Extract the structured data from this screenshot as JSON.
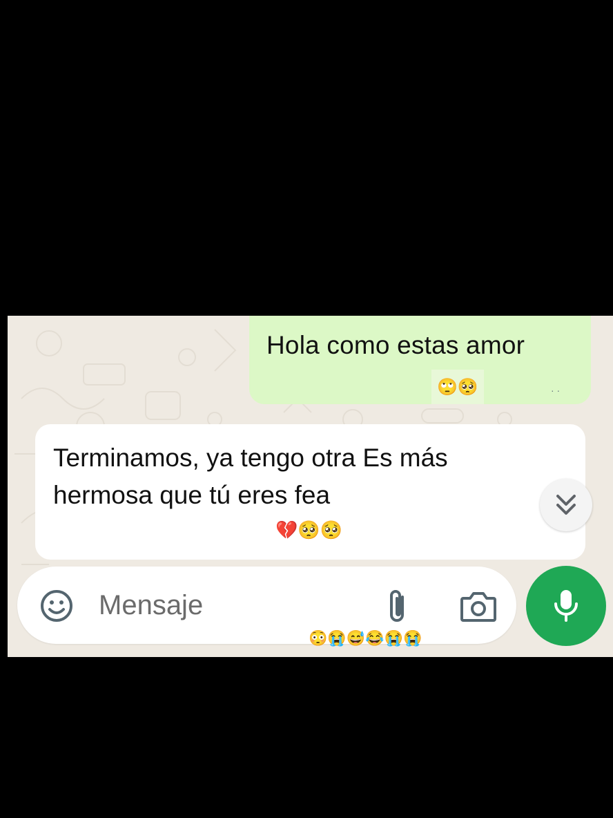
{
  "chat": {
    "outgoing": {
      "text": "Hola como estas amor",
      "emojis": "🙄🥺",
      "ticks": "· ·"
    },
    "incoming": {
      "line1": "Terminamos, ya tengo otra  Es más",
      "line2": "hermosa  que tú eres fea",
      "emojis": "💔🥺🥺"
    }
  },
  "composer": {
    "placeholder": "Mensaje"
  },
  "overlay": {
    "watermark": "😳😭😅😂😭😭"
  },
  "colors": {
    "outgoing_bubble": "#dcf8c6",
    "incoming_bubble": "#ffffff",
    "chat_background": "#efeae2",
    "mic_button": "#1fa855"
  },
  "icons": {
    "emoji": "smiley-icon",
    "attach": "paperclip-icon",
    "camera": "camera-icon",
    "mic": "microphone-icon",
    "scroll": "double-chevron-down-icon"
  }
}
